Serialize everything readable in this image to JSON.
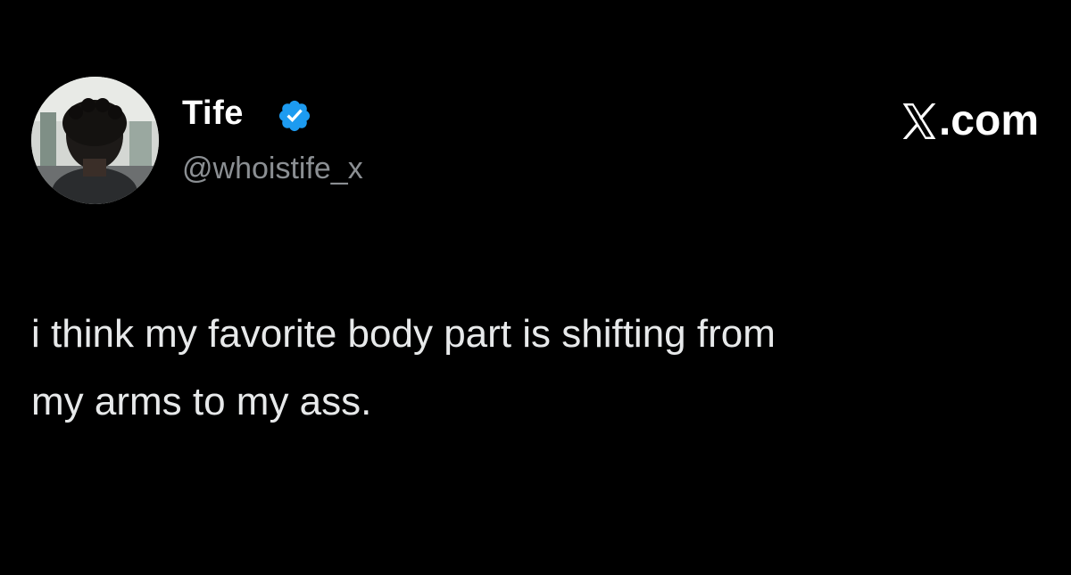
{
  "tweet": {
    "display_name": "Tife",
    "handle": "@whoistife_x",
    "verified": true,
    "brand_label": ".com",
    "text": "i think my favorite body part is shifting from\nmy arms to my ass."
  },
  "colors": {
    "background": "#000000",
    "name": "#ffffff",
    "handle": "#8b8f93",
    "text": "#e7e9ea",
    "verified_badge": "#1d9bf0"
  },
  "icons": {
    "verified": "verified-badge-icon",
    "brand": "x-logo-icon"
  }
}
